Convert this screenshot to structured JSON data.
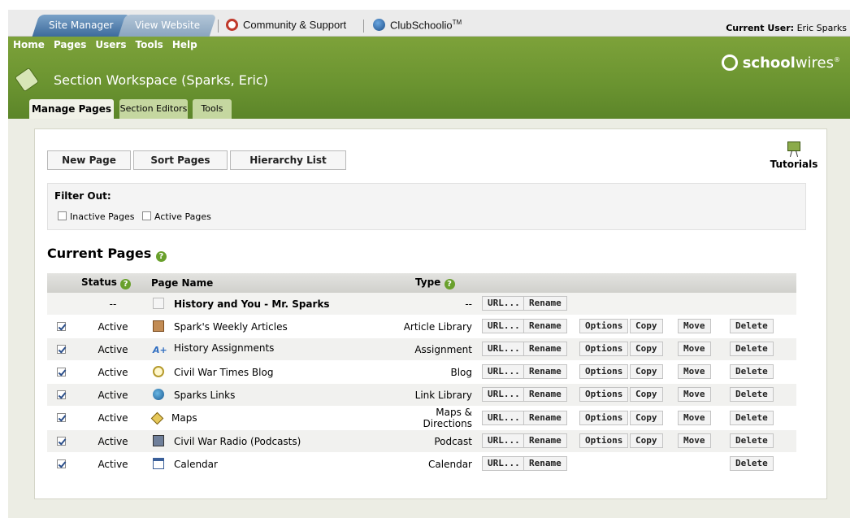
{
  "topbar": {
    "tab_site_manager": "Site Manager",
    "tab_view_website": "View Website",
    "community_support": "Community & Support",
    "club_schoolio": "ClubSchoolio",
    "club_tm": "TM",
    "current_user_label": "Current User:",
    "current_user_name": "Eric Sparks"
  },
  "menu": {
    "items": [
      "Home",
      "Pages",
      "Users",
      "Tools",
      "Help"
    ]
  },
  "header": {
    "workspace_title": "Section Workspace (Sparks, Eric)",
    "logo_bold": "school",
    "logo_rest": "wires",
    "logo_mark": "®"
  },
  "subtabs": {
    "manage_pages": "Manage Pages",
    "section_editors": "Section Editors",
    "tools": "Tools"
  },
  "toolbar": {
    "new_page": "New Page",
    "sort_pages": "Sort Pages",
    "hierarchy_list": "Hierarchy List",
    "tutorials": "Tutorials"
  },
  "filter": {
    "title": "Filter Out:",
    "inactive": "Inactive Pages",
    "active": "Active Pages"
  },
  "current_pages": {
    "title": "Current Pages",
    "columns": {
      "status": "Status",
      "page_name": "Page Name",
      "type": "Type"
    },
    "rows": [
      {
        "status": "--",
        "name": "History and You - Mr. Sparks",
        "type": "--",
        "icon": "page-icon",
        "checked": false
      },
      {
        "status": "Active",
        "name": "Spark's Weekly Articles",
        "type": "Article Library",
        "icon": "article-library-icon",
        "checked": true
      },
      {
        "status": "Active",
        "name": "History Assignments",
        "type": "Assignment",
        "icon": "assignment-icon",
        "checked": true
      },
      {
        "status": "Active",
        "name": "Civil War Times Blog",
        "type": "Blog",
        "icon": "blog-icon",
        "checked": true
      },
      {
        "status": "Active",
        "name": "Sparks Links",
        "type": "Link Library",
        "icon": "globe-icon",
        "checked": true
      },
      {
        "status": "Active",
        "name": "Maps",
        "type": "Maps & Directions",
        "icon": "maps-icon",
        "checked": true
      },
      {
        "status": "Active",
        "name": "Civil War Radio (Podcasts)",
        "type": "Podcast",
        "icon": "podcast-icon",
        "checked": true
      },
      {
        "status": "Active",
        "name": "Calendar",
        "type": "Calendar",
        "icon": "calendar-icon",
        "checked": true
      }
    ],
    "actions": {
      "url": "URL...",
      "rename": "Rename",
      "options": "Options",
      "copy": "Copy",
      "move": "Move",
      "delete": "Delete"
    }
  }
}
